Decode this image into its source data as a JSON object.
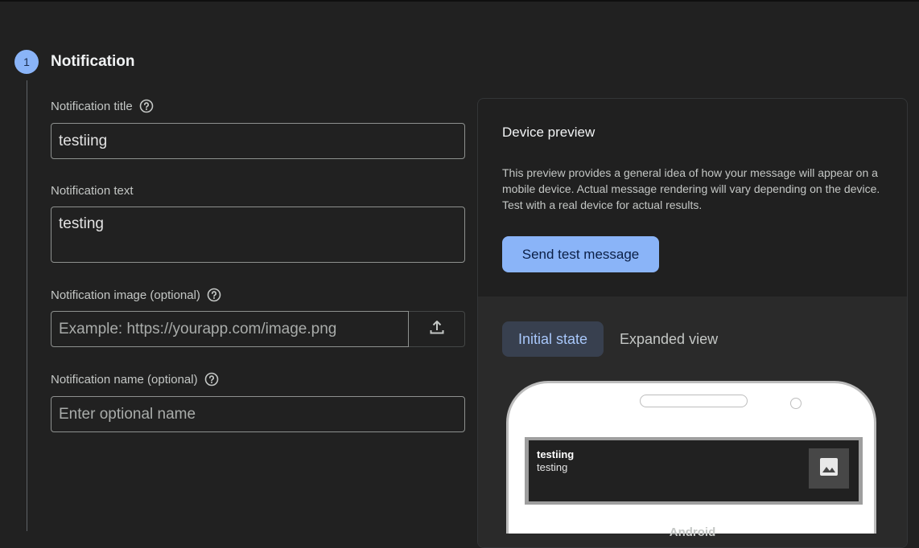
{
  "step": {
    "number": "1",
    "title": "Notification"
  },
  "form": {
    "title_label": "Notification title",
    "title_value": "testiing",
    "text_label": "Notification text",
    "text_value": "testing",
    "image_label": "Notification image (optional)",
    "image_placeholder": "Example: https://yourapp.com/image.png",
    "name_label": "Notification name (optional)",
    "name_placeholder": "Enter optional name",
    "help_icon": "help-circle-icon",
    "upload_icon": "upload-icon"
  },
  "preview": {
    "title": "Device preview",
    "description": "This preview provides a general idea of how your message will appear on a mobile device. Actual message rendering will vary depending on the device. Test with a real device for actual results.",
    "send_button": "Send test message",
    "tabs": [
      {
        "label": "Initial state",
        "selected": true
      },
      {
        "label": "Expanded view",
        "selected": false
      }
    ],
    "notification": {
      "title": "testiing",
      "body": "testing",
      "thumbnail_icon": "image-placeholder-icon"
    },
    "device_label": "Android"
  },
  "colors": {
    "background": "#212121",
    "accent": "#8ab4f8",
    "selected_tab_bg": "#38404f",
    "selected_tab_text": "#a8c7fa"
  }
}
